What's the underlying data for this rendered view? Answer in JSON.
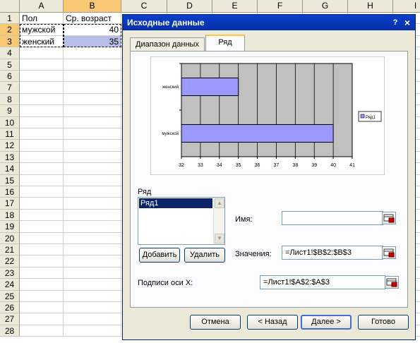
{
  "sheet": {
    "columns": [
      "A",
      "B",
      "C",
      "D",
      "E",
      "F",
      "G",
      "H",
      "I"
    ],
    "rows": [
      "1",
      "2",
      "3",
      "4",
      "5",
      "6",
      "7",
      "8",
      "9",
      "10",
      "11",
      "12",
      "13",
      "14",
      "15",
      "16",
      "17",
      "18",
      "19",
      "20",
      "21",
      "22",
      "23",
      "24",
      "25",
      "26",
      "27",
      "28"
    ],
    "cells": {
      "A1": "Пол",
      "B1": "Ср. возраст",
      "A2": "мужской",
      "B2": "40",
      "A3": "женский",
      "B3": "35"
    }
  },
  "dialog": {
    "title": "Исходные данные",
    "help_glyph": "?",
    "close_glyph": "×",
    "tabs": [
      {
        "label": "Диапазон данных",
        "active": false
      },
      {
        "label": "Ряд",
        "active": true
      }
    ],
    "series_group_label": "Ряд",
    "series_list": [
      "Ряд1"
    ],
    "add_button": "Добавить",
    "delete_button": "Удалить",
    "name_label": "Имя:",
    "name_value": "",
    "values_label": "Значения:",
    "values_value": "=Лист1!$B$2:$B$3",
    "xlabels_label": "Подписи оси X:",
    "xlabels_value": "=Лист1!$A$2:$A$3",
    "buttons": {
      "cancel": "Отмена",
      "back": "< Назад",
      "next": "Далее >",
      "finish": "Готово"
    }
  },
  "chart_data": {
    "type": "bar",
    "orientation": "horizontal",
    "categories": [
      "мужской",
      "женский"
    ],
    "series": [
      {
        "name": "Ряд1",
        "values": [
          40,
          35
        ]
      }
    ],
    "xlim": [
      32,
      41
    ],
    "ticks": [
      "32",
      "33",
      "34",
      "35",
      "36",
      "37",
      "38",
      "39",
      "40",
      "41"
    ],
    "grid": true,
    "legend": "right",
    "bar_color": "#9999ff",
    "plot_bg": "#c0c0c0"
  },
  "colors": {
    "title_bar": "#0a3ecb",
    "selection": "#b6bde6",
    "dialog_bg": "#ece9d8"
  }
}
